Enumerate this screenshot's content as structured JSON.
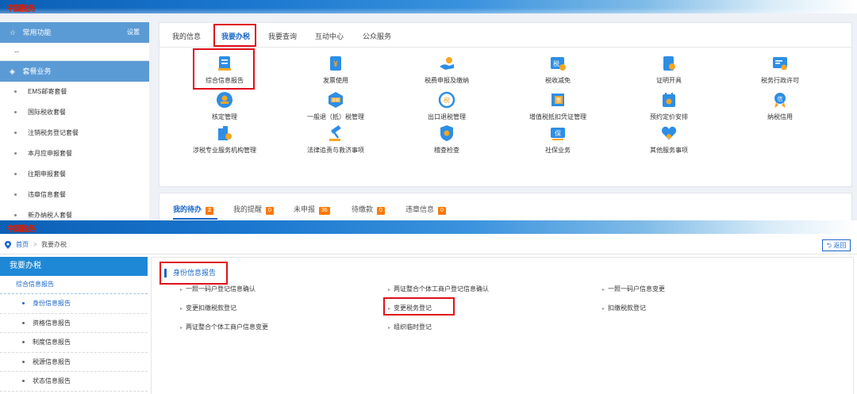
{
  "top": {
    "logo": "中国税务",
    "sidebar": {
      "common_label": "常用功能",
      "settings_label": "设置",
      "placeholder": "--",
      "package_label": "套餐业务",
      "items": [
        {
          "label": "EMS邮寄套餐"
        },
        {
          "label": "国际税收套餐"
        },
        {
          "label": "注销税务登记套餐"
        },
        {
          "label": "本月应申报套餐"
        },
        {
          "label": "往期申报套餐"
        },
        {
          "label": "违章信息套餐"
        },
        {
          "label": "新办纳税人套餐"
        }
      ]
    },
    "tabs": [
      {
        "label": "我的信息"
      },
      {
        "label": "我要办税"
      },
      {
        "label": "我要查询"
      },
      {
        "label": "互动中心"
      },
      {
        "label": "公众服务"
      }
    ],
    "services": [
      {
        "label": "综合信息报告",
        "icon": "report-icon"
      },
      {
        "label": "发票使用",
        "icon": "invoice-icon"
      },
      {
        "label": "税费申报及缴纳",
        "icon": "payment-icon"
      },
      {
        "label": "税收减免",
        "icon": "tax-relief-icon"
      },
      {
        "label": "证明开具",
        "icon": "certificate-icon"
      },
      {
        "label": "税务行政许可",
        "icon": "license-icon"
      },
      {
        "label": "核定管理",
        "icon": "stamp-icon"
      },
      {
        "label": "一般退（抵）税管理",
        "icon": "refund-icon"
      },
      {
        "label": "出口退税管理",
        "icon": "export-refund-icon"
      },
      {
        "label": "增值税抵扣凭证管理",
        "icon": "vat-voucher-icon"
      },
      {
        "label": "预约定价安排",
        "icon": "calendar-icon"
      },
      {
        "label": "纳税信用",
        "icon": "credit-icon"
      },
      {
        "label": "涉税专业服务机构管理",
        "icon": "agency-icon"
      },
      {
        "label": "法律追责与救济事项",
        "icon": "gavel-icon"
      },
      {
        "label": "稽查检查",
        "icon": "inspection-icon"
      },
      {
        "label": "社保业务",
        "icon": "social-security-icon"
      },
      {
        "label": "其他服务事项",
        "icon": "heart-icon"
      }
    ],
    "bottom_tabs": [
      {
        "label": "我的待办",
        "count": "2"
      },
      {
        "label": "我的提醒",
        "count": "0"
      },
      {
        "label": "未申报",
        "count": "36"
      },
      {
        "label": "待缴款",
        "count": "0"
      },
      {
        "label": "违章信息",
        "count": "0"
      }
    ]
  },
  "bottom": {
    "logo": "中国税务",
    "breadcrumb": {
      "home": "首页",
      "separator": ">",
      "current": "我要办税"
    },
    "back_label": "返回",
    "left": {
      "title": "我要办税",
      "sub": "综合信息报告",
      "items": [
        {
          "label": "身份信息报告"
        },
        {
          "label": "资格信息报告"
        },
        {
          "label": "制度信息报告"
        },
        {
          "label": "税源信息报告"
        },
        {
          "label": "状态信息报告"
        }
      ]
    },
    "section_title": "身份信息报告",
    "links": [
      {
        "label": "一照一码户登记信息确认"
      },
      {
        "label": "两证整合个体工商户登记信息确认"
      },
      {
        "label": "一照一码户信息变更"
      },
      {
        "label": "变更扣缴税款登记"
      },
      {
        "label": "变更税务登记"
      },
      {
        "label": "扣缴税款登记"
      },
      {
        "label": "两证整合个体工商户信息变更"
      },
      {
        "label": "组织临时登记"
      }
    ]
  },
  "colors": {
    "accent": "#1a66c7",
    "highlight": "#e0101a",
    "badge": "#ff7a00",
    "sidebar_head": "#5b9bd5"
  }
}
